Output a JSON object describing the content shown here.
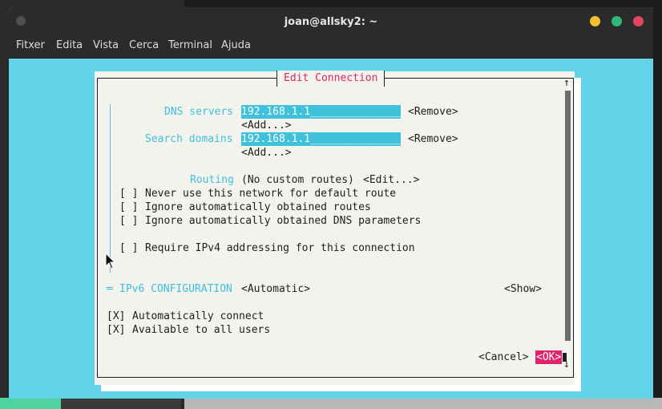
{
  "window": {
    "title": "joan@allsky2: ~",
    "menu": [
      "Fitxer",
      "Edita",
      "Vista",
      "Cerca",
      "Terminal",
      "Ajuda"
    ]
  },
  "dialog": {
    "title": "Edit Connection",
    "dns_label": "DNS servers",
    "dns_value": "192.168.1.1_______________",
    "dns_remove": "<Remove>",
    "dns_add": "<Add...>",
    "search_label": "Search domains",
    "search_value": "192.168.1.1_______________",
    "search_remove": "<Remove>",
    "search_add": "<Add...>",
    "routing_label": "Routing",
    "routing_value": "(No custom routes)",
    "routing_edit": "<Edit...>",
    "checkboxes": [
      {
        "mark": "[ ]",
        "label": "Never use this network for default route"
      },
      {
        "mark": "[ ]",
        "label": "Ignore automatically obtained routes"
      },
      {
        "mark": "[ ]",
        "label": "Ignore automatically obtained DNS parameters"
      },
      {
        "mark": "[ ]",
        "label": "Require IPv4 addressing for this connection"
      }
    ],
    "ipv6_prefix": "═",
    "ipv6_label": "IPv6 CONFIGURATION",
    "ipv6_value": "<Automatic>",
    "ipv6_show": "<Show>",
    "options": [
      {
        "mark": "[X]",
        "label": "Automatically connect"
      },
      {
        "mark": "[X]",
        "label": "Available to all users"
      }
    ],
    "cancel": "<Cancel>",
    "ok": "<OK>",
    "scroll_up": "↑",
    "scroll_down": "↓"
  }
}
